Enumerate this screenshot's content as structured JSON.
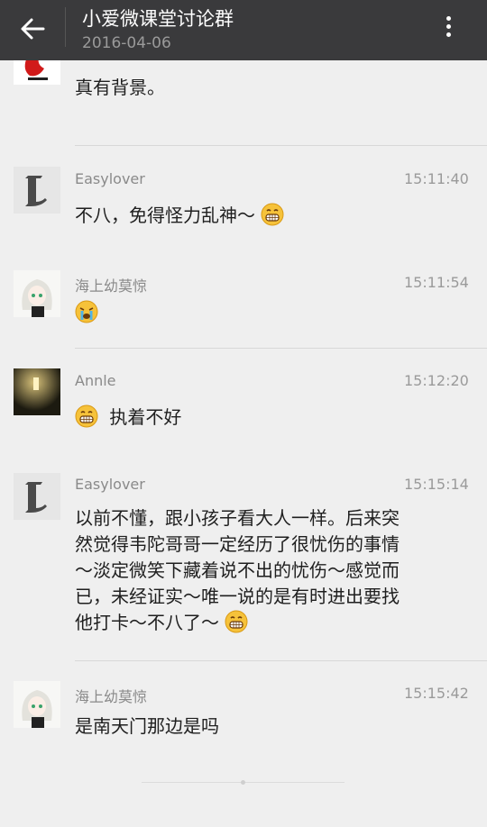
{
  "header": {
    "title": "小爱微课堂讨论群",
    "date": "2016-04-06",
    "back_icon": "arrow-left-icon",
    "more_icon": "more-vertical-icon"
  },
  "messages": [
    {
      "text": "真有背景。"
    },
    {
      "sender": "Easylover",
      "time": "15:11:40",
      "text": "不八，免得怪力乱神～",
      "emoji": "grin-emoji"
    },
    {
      "sender": "海上幼莫惊",
      "time": "15:11:54",
      "emoji": "crying-emoji"
    },
    {
      "sender": "Annle",
      "time": "15:12:20",
      "text": "执着不好",
      "emoji": "grin-emoji"
    },
    {
      "sender": "Easylover",
      "time": "15:15:14",
      "lines": [
        "以前不懂，跟小孩子看大人一样。后来突",
        "然觉得韦陀哥哥一定经历了很忧伤的事情",
        "～淡定微笑下藏着说不出的忧伤～感觉而",
        "已，未经证实～唯一说的是有时进出要找",
        "他打卡～不八了～"
      ],
      "emoji": "grin-emoji"
    },
    {
      "sender": "海上幼莫惊",
      "time": "15:15:42",
      "text": "是南天门那边是吗"
    }
  ],
  "colors": {
    "header_bg": "#3a3a3c",
    "page_bg": "#efefef",
    "emoji_yellow": "#f6c23a"
  }
}
